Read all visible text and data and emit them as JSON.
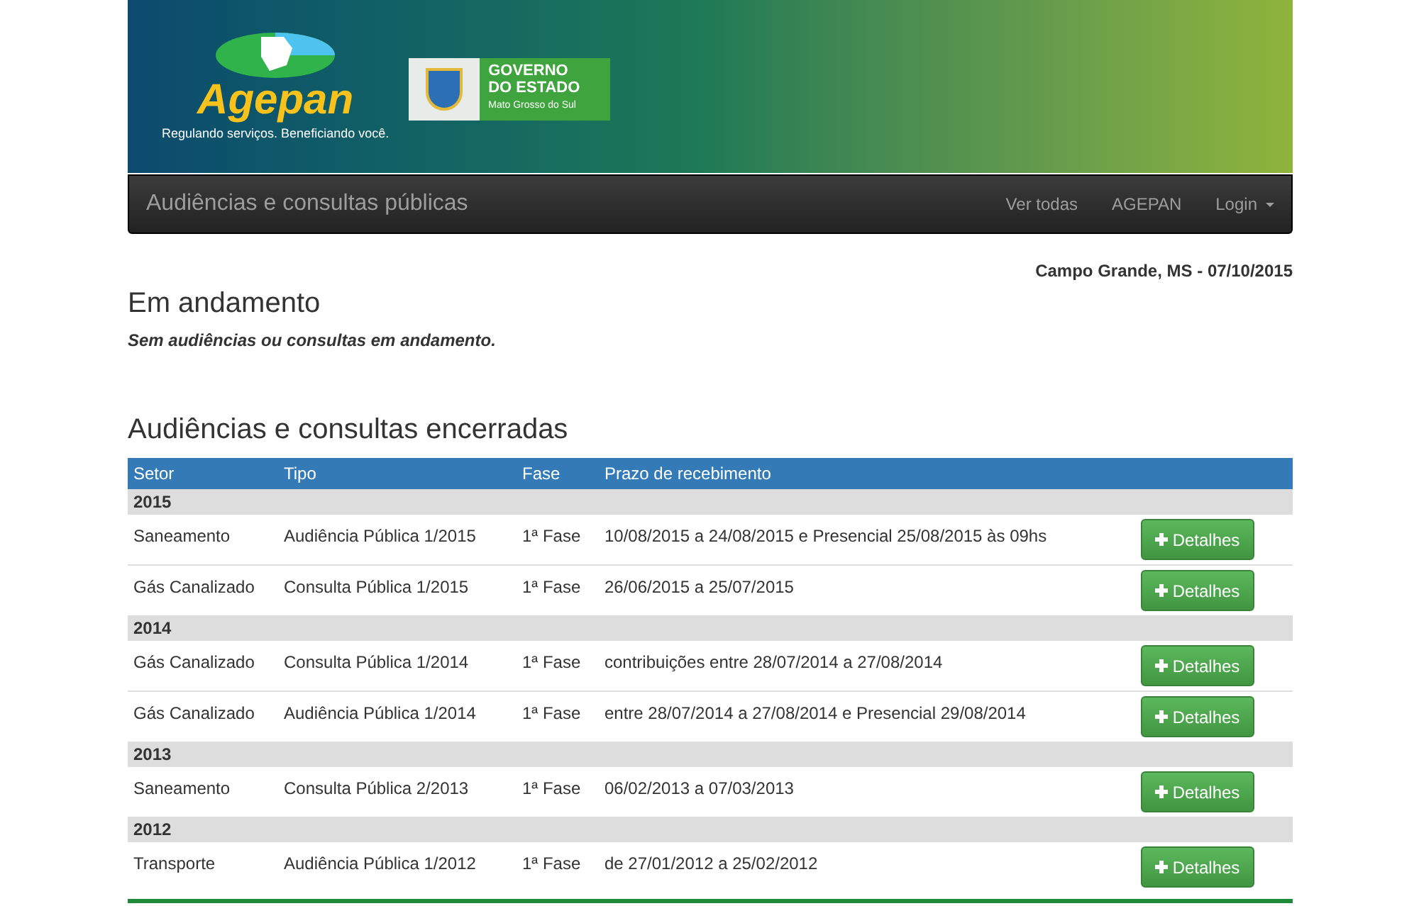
{
  "banner": {
    "logo_text": "Agepan",
    "slogan": "Regulando serviços. Beneficiando você.",
    "gov_lines": [
      "GOVERNO",
      "DO ESTADO"
    ],
    "gov_state": "Mato Grosso do Sul"
  },
  "navbar": {
    "brand": "Audiências e consultas públicas",
    "links": [
      {
        "label": "Ver todas",
        "kind": "link"
      },
      {
        "label": "AGEPAN",
        "kind": "link"
      },
      {
        "label": "Login",
        "kind": "dropdown"
      }
    ]
  },
  "location_date": "Campo Grande, MS - 07/10/2015",
  "ongoing": {
    "title": "Em andamento",
    "message": "Sem audiências ou consultas em andamento."
  },
  "closed": {
    "title": "Audiências e consultas encerradas",
    "columns": [
      "Setor",
      "Tipo",
      "Fase",
      "Prazo de recebimento"
    ],
    "groups": [
      {
        "year": "2015",
        "rows": [
          {
            "setor": "Saneamento",
            "tipo": "Audiência Pública 1/2015",
            "fase": "1ª Fase",
            "prazo": "10/08/2015 a 24/08/2015 e Presencial 25/08/2015 às 09hs",
            "button": "Detalhes"
          },
          {
            "setor": "Gás Canalizado",
            "tipo": "Consulta Pública 1/2015",
            "fase": "1ª Fase",
            "prazo": "26/06/2015 a 25/07/2015",
            "button": "Detalhes"
          }
        ]
      },
      {
        "year": "2014",
        "rows": [
          {
            "setor": "Gás Canalizado",
            "tipo": "Consulta Pública 1/2014",
            "fase": "1ª Fase",
            "prazo": "contribuições entre 28/07/2014 a 27/08/2014",
            "button": "Detalhes"
          },
          {
            "setor": "Gás Canalizado",
            "tipo": "Audiência Pública 1/2014",
            "fase": "1ª Fase",
            "prazo": "entre 28/07/2014 a 27/08/2014 e Presencial 29/08/2014",
            "button": "Detalhes"
          }
        ]
      },
      {
        "year": "2013",
        "rows": [
          {
            "setor": "Saneamento",
            "tipo": "Consulta Pública 2/2013",
            "fase": "1ª Fase",
            "prazo": "06/02/2013 a 07/03/2013",
            "button": "Detalhes"
          }
        ]
      },
      {
        "year": "2012",
        "rows": [
          {
            "setor": "Transporte",
            "tipo": "Audiência Pública 1/2012",
            "fase": "1ª Fase",
            "prazo": "de 27/01/2012 a 25/02/2012",
            "button": "Detalhes"
          }
        ]
      }
    ]
  }
}
